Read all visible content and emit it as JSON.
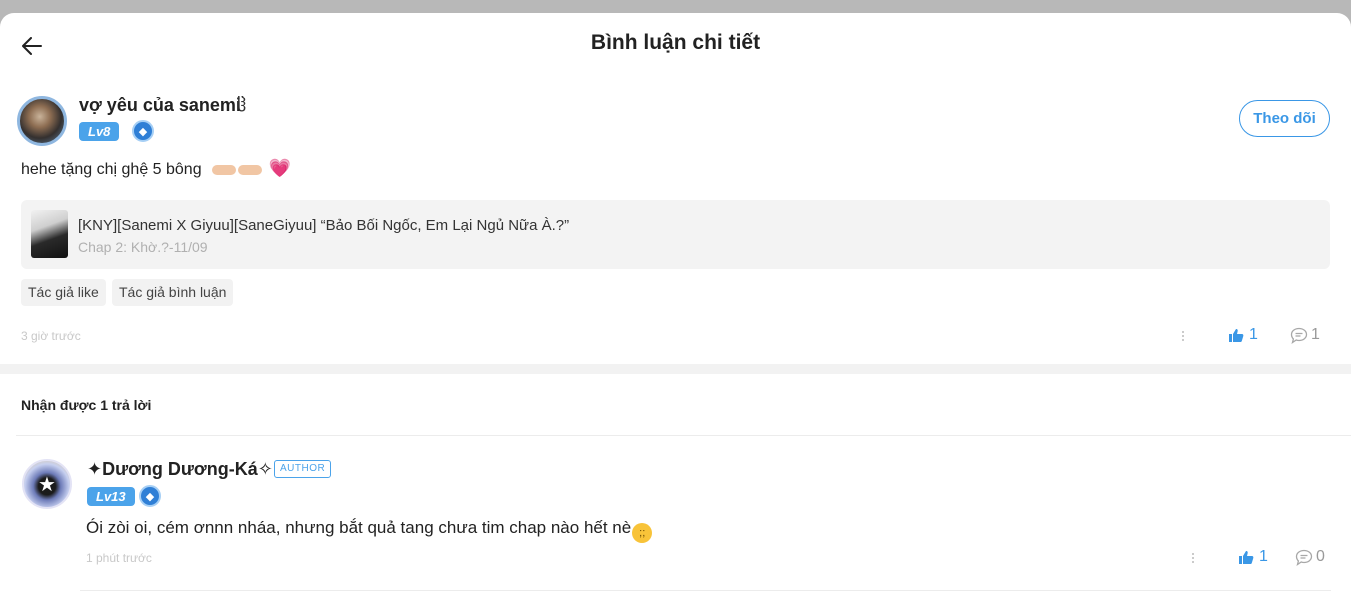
{
  "header": {
    "title": "Bình luận chi tiết"
  },
  "comment": {
    "username": "vợ yêu của sanemi",
    "username_mark": "ჱ",
    "level": "Lv8",
    "follow_label": "Theo dõi",
    "text": "hehe tặng chị ghệ 5 bông",
    "heart": "💗",
    "story": {
      "title": "[KNY][Sanemi X Giyuu][SaneGiyuu] “Bảo Bối Ngốc, Em Lại Ngủ Nữa À.?”",
      "chapter": "Chap 2: Khờ.?-11/09"
    },
    "tags": [
      "Tác giả like",
      "Tác giả bình luận"
    ],
    "time": "3 giờ trước",
    "likes": "1",
    "replies": "1"
  },
  "replies_section": {
    "heading": "Nhận được 1 trả lời"
  },
  "reply": {
    "username": "✦Dương Dương-Ká✧",
    "author_badge": "AUTHOR",
    "level": "Lv13",
    "text": "Ói zòi oi, cém ơnnn nháa, nhưng bắt quả tang chưa tim chap nào hết nè",
    "time": "1 phút trước",
    "likes": "1",
    "replies": "0"
  },
  "colors": {
    "accent": "#3a97e6",
    "level_badge": "#4ba3ea"
  }
}
